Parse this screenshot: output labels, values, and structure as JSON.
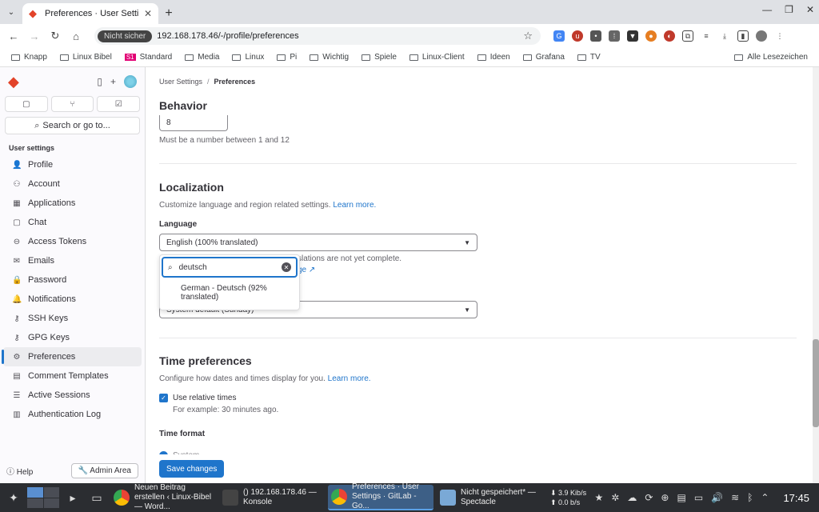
{
  "browser": {
    "tab_title": "Preferences · User Settings",
    "security_label": "Nicht sicher",
    "url": "192.168.178.46/-/profile/preferences",
    "bookmarks": [
      "Knapp",
      "Linux Bibel",
      "Standard",
      "Media",
      "Linux",
      "Pi",
      "Wichtig",
      "Spiele",
      "Linux-Client",
      "Ideen",
      "Grafana",
      "TV"
    ],
    "all_bookmarks": "Alle Lesezeichen"
  },
  "sidebar": {
    "search": "Search or go to...",
    "section": "User settings",
    "items": [
      {
        "label": "Profile",
        "icon": "👤"
      },
      {
        "label": "Account",
        "icon": "⚇"
      },
      {
        "label": "Applications",
        "icon": "▦"
      },
      {
        "label": "Chat",
        "icon": "▢"
      },
      {
        "label": "Access Tokens",
        "icon": "⊖"
      },
      {
        "label": "Emails",
        "icon": "✉"
      },
      {
        "label": "Password",
        "icon": "🔒"
      },
      {
        "label": "Notifications",
        "icon": "🔔"
      },
      {
        "label": "SSH Keys",
        "icon": "⚷"
      },
      {
        "label": "GPG Keys",
        "icon": "⚷"
      },
      {
        "label": "Preferences",
        "icon": "⚙"
      },
      {
        "label": "Comment Templates",
        "icon": "▤"
      },
      {
        "label": "Active Sessions",
        "icon": "☰"
      },
      {
        "label": "Authentication Log",
        "icon": "▥"
      }
    ],
    "help": "Help",
    "admin": "Admin Area"
  },
  "main": {
    "breadcrumb_parent": "User Settings",
    "breadcrumb_current": "Preferences",
    "behavior_title": "Behavior",
    "number_value": "8",
    "number_hint": "Must be a number between 1 and 12",
    "localization_title": "Localization",
    "localization_desc": "Customize language and region related settings.",
    "learn_more": "Learn more.",
    "language_label": "Language",
    "language_value": "English (100% translated)",
    "language_hint": "slations are not yet complete.",
    "language_hint_link": "ge",
    "dropdown_search": "deutsch",
    "dropdown_option": "German - Deutsch (92% translated)",
    "first_day_value": "System default (Sunday)",
    "time_title": "Time preferences",
    "time_desc": "Configure how dates and times display for you.",
    "relative_label": "Use relative times",
    "relative_help": "For example: 30 minutes ago.",
    "time_format_label": "Time format",
    "radio_peek": "System",
    "save": "Save changes"
  },
  "taskbar": {
    "tasks": [
      {
        "title": "Neuen Beitrag erstellen ‹ Linux-Bibel — Word..."
      },
      {
        "title": "() 192.168.178.46 — Konsole"
      },
      {
        "title": "Preferences · User Settings · GitLab - Go..."
      },
      {
        "title": "Nicht gespeichert* — Spectacle"
      }
    ],
    "net_down": "3.9 Kib/s",
    "net_up": "0.0 b/s",
    "clock": "17:45"
  },
  "colors": {
    "accent": "#1f75cb",
    "gitlab_orange": "#e24329"
  }
}
